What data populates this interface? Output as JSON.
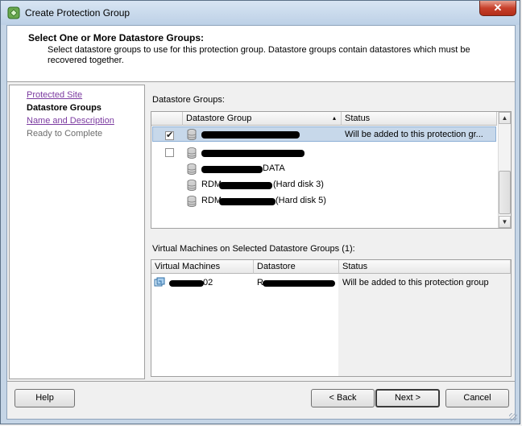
{
  "window": {
    "title": "Create Protection Group",
    "close_glyph": "✕"
  },
  "header": {
    "title": "Select One or More Datastore Groups:",
    "description": "Select datastore groups to use for this protection group. Datastore groups contain datastores which must be recovered together."
  },
  "nav": {
    "items": [
      {
        "label": "Protected Site",
        "state": "link"
      },
      {
        "label": "Datastore Groups",
        "state": "current"
      },
      {
        "label": "Name and Description",
        "state": "link"
      },
      {
        "label": "Ready to Complete",
        "state": "future"
      }
    ]
  },
  "datastore_groups": {
    "label": "Datastore Groups:",
    "columns": [
      "Datastore Group",
      "Status"
    ],
    "sort_glyph": "▴",
    "rows": [
      {
        "checked": true,
        "name_suffix": "",
        "status": "Will be added to this protection gr..."
      },
      {
        "checked": false,
        "name_suffix": "",
        "status": ""
      },
      {
        "checked": null,
        "name_suffix": "DATA",
        "status": ""
      },
      {
        "checked": null,
        "name_prefix": "RDM",
        "name_suffix": "(Hard disk 3)",
        "status": ""
      },
      {
        "checked": null,
        "name_prefix": "RDM",
        "name_suffix": "(Hard disk 5)",
        "status": ""
      }
    ]
  },
  "virtual_machines": {
    "label": "Virtual Machines on Selected Datastore Groups (1):",
    "columns": [
      "Virtual Machines",
      "Datastore",
      "Status"
    ],
    "rows": [
      {
        "vm_suffix": "02",
        "datastore_prefix": "R",
        "status": "Will be added to this protection group"
      }
    ]
  },
  "buttons": {
    "help": "Help",
    "back": "< Back",
    "next": "Next >",
    "cancel": "Cancel"
  },
  "colors": {
    "selection": "#c7d8ea",
    "visited_link": "#7b3aa0",
    "close_button": "#c7402b"
  },
  "icons": [
    "app-icon",
    "close-icon",
    "database-icon",
    "virtual-machine-icon",
    "scroll-up-icon",
    "scroll-down-icon",
    "sort-icon"
  ]
}
